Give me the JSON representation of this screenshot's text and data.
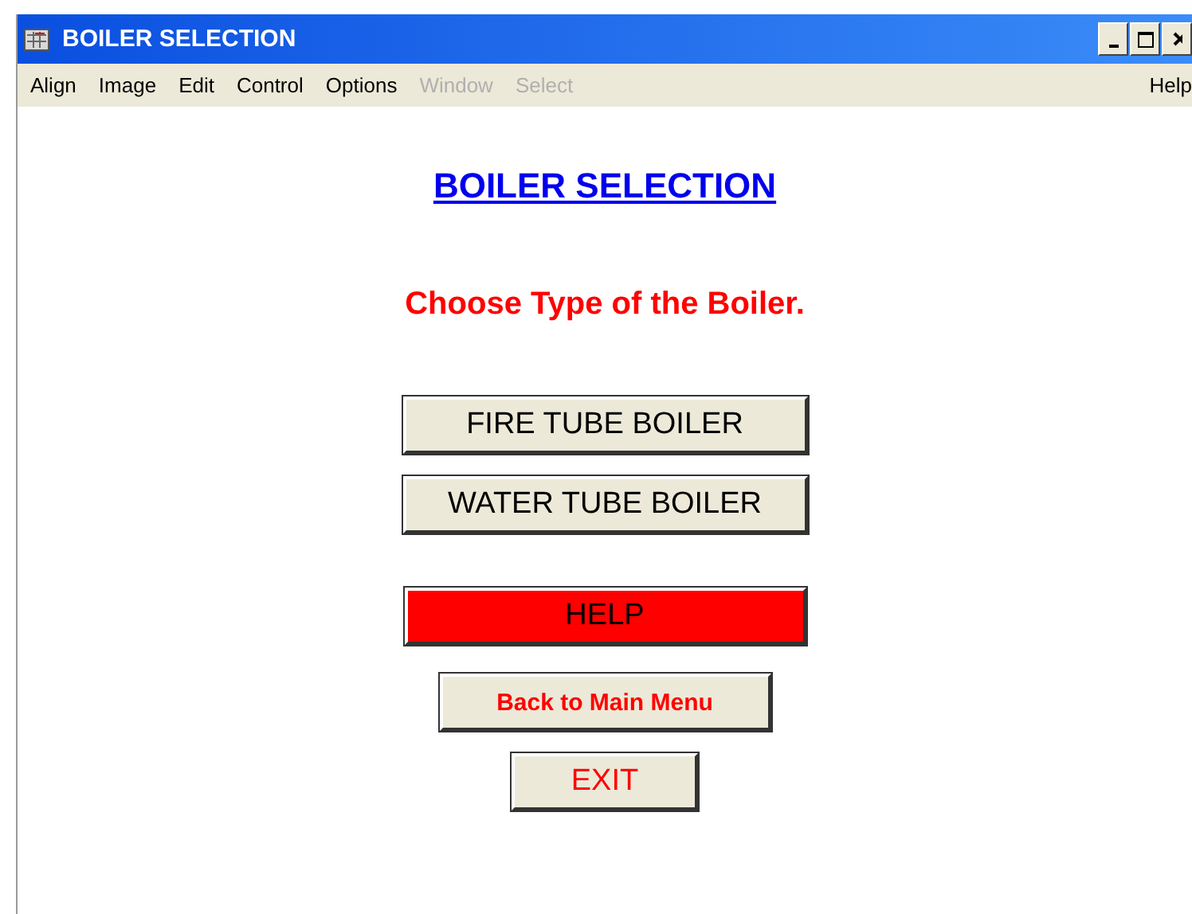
{
  "window": {
    "title": "BOILER SELECTION"
  },
  "menu": [
    {
      "label": "Align",
      "disabled": false
    },
    {
      "label": "Image",
      "disabled": false
    },
    {
      "label": "Edit",
      "disabled": false
    },
    {
      "label": "Control",
      "disabled": false
    },
    {
      "label": "Options",
      "disabled": false
    },
    {
      "label": "Window",
      "disabled": true
    },
    {
      "label": "Select",
      "disabled": true
    }
  ],
  "menu_help": "Help",
  "heading": "BOILER SELECTION",
  "prompt": "Choose Type of the Boiler.",
  "buttons": [
    {
      "label": "FIRE TUBE BOILER",
      "kind": "choice"
    },
    {
      "label": "WATER TUBE BOILER",
      "kind": "choice"
    },
    {
      "label": "HELP",
      "kind": "alert"
    },
    {
      "label": "Back to Main Menu",
      "kind": "nav"
    },
    {
      "label": "EXIT",
      "kind": "exit"
    }
  ]
}
